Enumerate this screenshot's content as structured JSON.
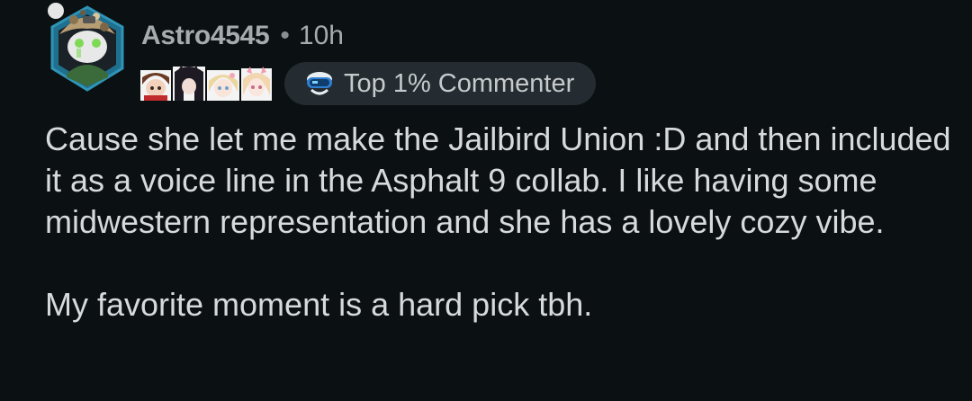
{
  "comment": {
    "username": "Astro4545",
    "separator": "•",
    "time_ago": "10h",
    "badge_label": "Top 1% Commenter",
    "paragraphs": [
      "Cause she let me make the Jailbird Union :D and then included it as a voice line in the Asphalt 9 collab. I like having some midwestern representation and she has a lovely cozy vibe.",
      "My favorite moment is a hard pick tbh."
    ]
  },
  "icons": {
    "avatar": "user-avatar-icon",
    "flair_avatars": [
      "flair-avatar-1-icon",
      "flair-avatar-2-icon",
      "flair-avatar-3-icon",
      "flair-avatar-4-icon"
    ],
    "badge": "top-commenter-badge-icon"
  },
  "colors": {
    "background": "#0b1012",
    "text": "#d7dadc",
    "meta": "#a6abae",
    "badge_bg": "#242c31",
    "avatar_ring": "#2b6f8f"
  }
}
